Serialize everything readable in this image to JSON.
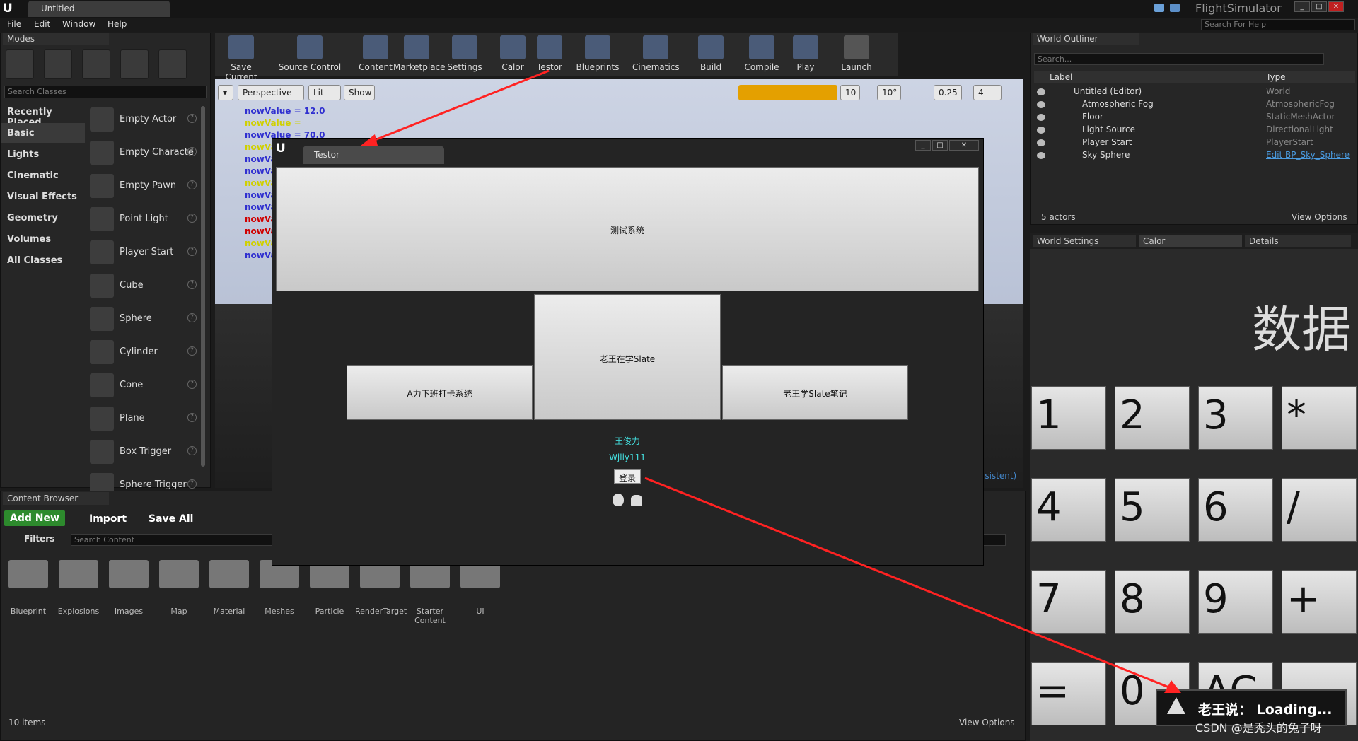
{
  "app": {
    "doc_tab": "Untitled",
    "project": "FlightSimulator",
    "help_placeholder": "Search For Help"
  },
  "menu": [
    "File",
    "Edit",
    "Window",
    "Help"
  ],
  "modes": {
    "tab": "Modes",
    "search_placeholder": "Search Classes",
    "categories": [
      "Recently Placed",
      "Basic",
      "Lights",
      "Cinematic",
      "Visual Effects",
      "Geometry",
      "Volumes",
      "All Classes"
    ],
    "items": [
      "Empty Actor",
      "Empty Characte",
      "Empty Pawn",
      "Point Light",
      "Player Start",
      "Cube",
      "Sphere",
      "Cylinder",
      "Cone",
      "Plane",
      "Box Trigger",
      "Sphere Trigger"
    ]
  },
  "toolbar": [
    "Save Current",
    "Source Control",
    "Content",
    "Marketplace",
    "Settings",
    "Calor",
    "Testor",
    "Blueprints",
    "Cinematics",
    "Build",
    "Compile",
    "Play",
    "Launch"
  ],
  "viewport": {
    "perspective": "Perspective",
    "lit": "Lit",
    "show": "Show",
    "snap1": "10",
    "snap2": "10°",
    "snap3": "0.25",
    "cam": "4",
    "persistent": "ersistent)",
    "debug": [
      "nowValue = 12.0",
      "nowValue =",
      "nowValue = 70.0",
      "nowVa",
      "nowVa",
      "nowVa",
      "nowVa",
      "nowVa",
      "nowVa",
      "nowVa",
      "nowVa",
      "nowVa",
      "nowVa"
    ]
  },
  "testor": {
    "tab": "Testor",
    "top_button": "测试系统",
    "mid_button": "老王在学Slate",
    "left_button": "A力下班打卡系统",
    "right_button": "老王学Slate笔记",
    "name": "王俊力",
    "user": "Wjliy111",
    "login": "登录"
  },
  "outliner": {
    "tab": "World Outliner",
    "search_placeholder": "Search...",
    "col_label": "Label",
    "col_type": "Type",
    "rows": [
      {
        "label": "Untitled (Editor)",
        "type": "World"
      },
      {
        "label": "Atmospheric Fog",
        "type": "AtmosphericFog"
      },
      {
        "label": "Floor",
        "type": "StaticMeshActor"
      },
      {
        "label": "Light Source",
        "type": "DirectionalLight"
      },
      {
        "label": "Player Start",
        "type": "PlayerStart"
      },
      {
        "label": "Sky Sphere",
        "type": "Edit BP_Sky_Sphere"
      }
    ],
    "count": "5 actors",
    "view_options": "View Options"
  },
  "details_tabs": [
    "World Settings",
    "Calor",
    "Details"
  ],
  "calc": {
    "display": "数据",
    "keys": [
      "1",
      "2",
      "3",
      "*",
      "4",
      "5",
      "6",
      "/",
      "7",
      "8",
      "9",
      "+",
      "=",
      "0",
      "AC",
      ""
    ]
  },
  "toast": "老王说： Loading...",
  "content": {
    "tab": "Content Browser",
    "add_new": "Add New",
    "import": "Import",
    "save_all": "Save All",
    "filters": "Filters",
    "search_placeholder": "Search Content",
    "folders": [
      "Blueprint",
      "Explosions",
      "Images",
      "Map",
      "Material",
      "Meshes",
      "Particle",
      "RenderTarget",
      "Starter Content",
      "UI"
    ],
    "count": "10 items",
    "view_options": "View Options"
  },
  "watermark": "CSDN @是秃头的兔子呀"
}
